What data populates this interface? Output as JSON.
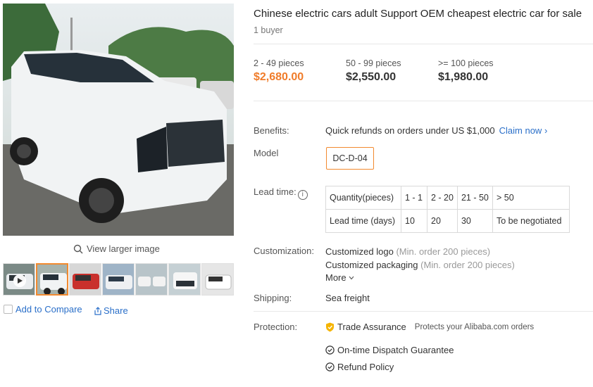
{
  "product": {
    "title": "Chinese electric cars adult Support OEM cheapest electric car for sale",
    "buyers": "1 buyer"
  },
  "gallery": {
    "view_larger": "View larger image",
    "add_to_compare": "Add to Compare",
    "share": "Share",
    "thumb_count": 7,
    "active_thumb_index": 1
  },
  "price_tiers": [
    {
      "qty": "2 - 49 pieces",
      "price": "$2,680.00"
    },
    {
      "qty": "50 - 99 pieces",
      "price": "$2,550.00"
    },
    {
      "qty": ">= 100 pieces",
      "price": "$1,980.00"
    }
  ],
  "benefits": {
    "label": "Benefits:",
    "text": "Quick refunds on orders under US $1,000",
    "link": "Claim now",
    "link_chevron": "›"
  },
  "model": {
    "label": "Model",
    "option": "DC-D-04"
  },
  "lead_time": {
    "label": "Lead time:",
    "info_glyph": "i",
    "rows": [
      [
        "Quantity(pieces)",
        "1 - 1",
        "2 - 20",
        "21 - 50",
        "> 50"
      ],
      [
        "Lead time (days)",
        "10",
        "20",
        "30",
        "To be negotiated"
      ]
    ]
  },
  "customization": {
    "label": "Customization:",
    "items": [
      {
        "name": "Customized logo",
        "note": "(Min. order 200 pieces)"
      },
      {
        "name": "Customized packaging",
        "note": "(Min. order 200 pieces)"
      }
    ],
    "more": "More"
  },
  "shipping": {
    "label": "Shipping:",
    "value": "Sea freight"
  },
  "protection": {
    "label": "Protection:",
    "trade_assurance": "Trade Assurance",
    "trade_sub": "Protects your Alibaba.com orders",
    "guarantees": [
      "On-time Dispatch Guarantee",
      "Refund Policy"
    ]
  },
  "colors": {
    "accent_orange": "#f07c2a",
    "link_blue": "#2a6fc9",
    "selected_border": "#f28a2f"
  }
}
